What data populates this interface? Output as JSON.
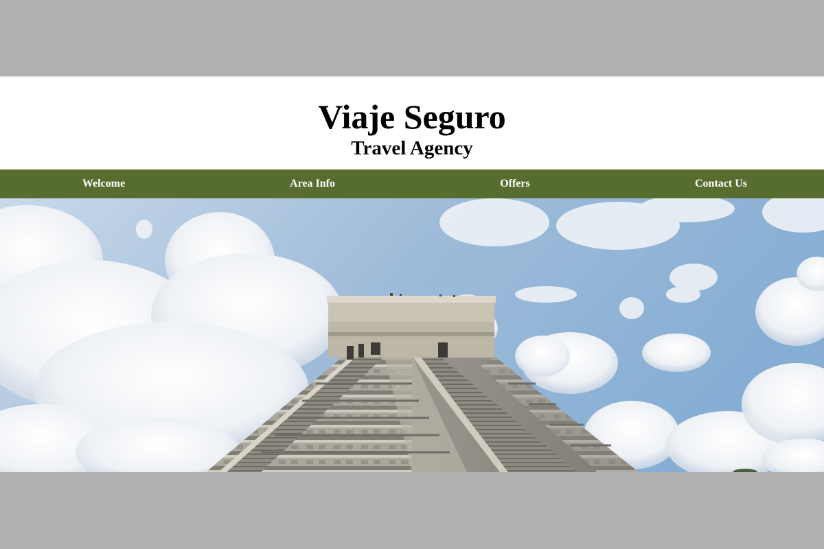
{
  "header": {
    "title": "Viaje Seguro",
    "subtitle": "Travel Agency"
  },
  "nav": {
    "items": [
      {
        "label": "Welcome"
      },
      {
        "label": "Area Info"
      },
      {
        "label": "Offers"
      },
      {
        "label": "Contact Us"
      }
    ]
  },
  "hero": {
    "image": "chichen-itza-pyramid-photo"
  },
  "colors": {
    "page_background": "#b0b0b0",
    "header_background": "#ffffff",
    "nav_background": "#566d2f",
    "nav_text": "#ffffff"
  }
}
